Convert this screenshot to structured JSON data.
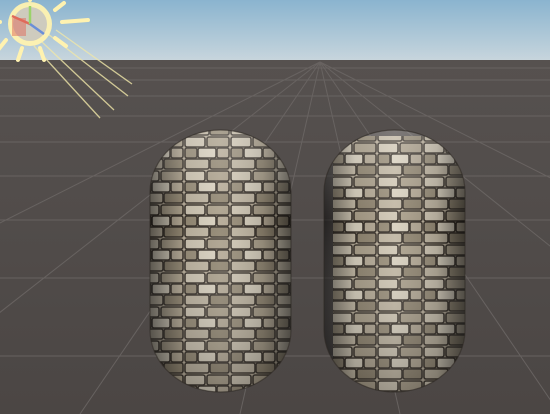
{
  "scene_view": {
    "colors": {
      "sky_top": "#8ab4cf",
      "sky_horizon": "#c9d6dd",
      "ground": "#4b4644",
      "ground_far": "#56514f",
      "grid_line": "#6c6765",
      "stone_light": "#d8d0c0",
      "stone_mid": "#9e9482",
      "stone_dark": "#3b342c",
      "sun": "#fff2b0",
      "sun_ray": "#f0e7a8",
      "gizmo_red": "#e06a5a",
      "gizmo_green": "#9bd36a",
      "gizmo_blue": "#6a8fd8"
    },
    "objects": [
      {
        "name": "capsule",
        "material": "stone-brick"
      },
      {
        "name": "capsule",
        "material": "stone-brick"
      }
    ],
    "light_gizmo": {
      "type": "directional-light",
      "icon": "sun-icon"
    }
  }
}
